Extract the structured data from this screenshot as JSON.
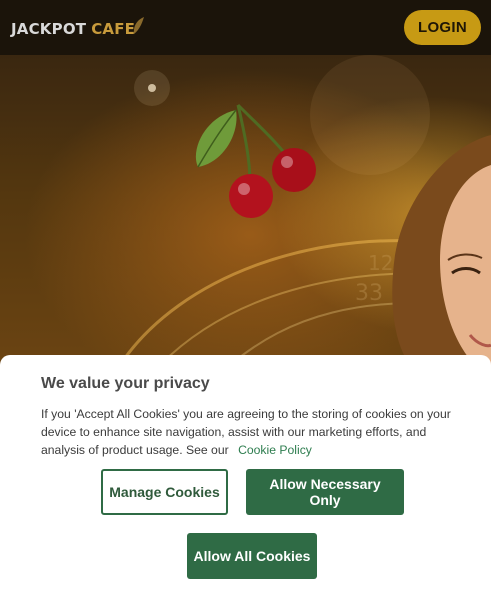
{
  "header": {
    "logo_primary": "JACKPOT",
    "logo_secondary": "CAFE",
    "login_label": "LOGIN"
  },
  "colors": {
    "login_button": "#c79a14",
    "logo_accent": "#c89b3c",
    "cookie_button": "#2f6b45",
    "cookie_link": "#2e7d4f"
  },
  "cookie_banner": {
    "title": "We value your privacy",
    "body": "If you 'Accept All Cookies' you are agreeing to the storing of cookies on your device to enhance site navigation, assist with our marketing efforts, and analysis of product usage. See our",
    "policy_link": "Cookie Policy",
    "manage_label": "Manage Cookies",
    "necessary_label": "Allow Necessary Only",
    "all_label": "Allow All Cookies"
  }
}
